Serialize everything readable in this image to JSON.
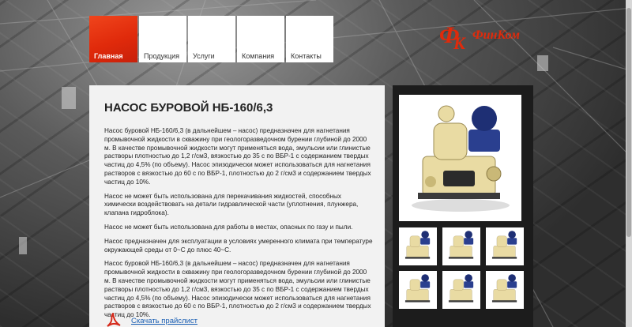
{
  "nav": {
    "items": [
      {
        "label": "Главная",
        "active": true
      },
      {
        "label": "Продукция",
        "active": false
      },
      {
        "label": "Услуги",
        "active": false
      },
      {
        "label": "Компания",
        "active": false
      },
      {
        "label": "Контакты",
        "active": false
      }
    ]
  },
  "logo": {
    "text": "ФинКом"
  },
  "page": {
    "title": "НАСОС БУРОВОЙ НБ-160/6,3",
    "paragraphs": [
      "Насос буровой НБ-160/6,3 (в дальнейшем – насос) предназначен для нагнетания промывочной жидкости в скважину при геологоразведочном бурении глубиной до 2000 м. В качестве промывочной жидкости могут применяться вода, эмульсии или глинистые растворы плотностью до 1,2 г/см3, вязкостью до 35 с по ВБР-1 с содержанием твердых частиц до 4,5% (по объему). Насос эпизодически может использоваться для нагнетания растворов с вязкостью до 60 с по ВБР-1, плотностью до 2 г/см3 и содержанием твердых частиц до 10%.",
      "Насос не может быть использована для перекачивания жидкостей, способных химически воздействовать на детали гидравлической части (уплотнения, плунжера, клапана гидроблока).",
      "Насос не может быть использована для работы в местах, опасных по газу и пыли.",
      "Насос предназначен для эксплуатации в условиях умеренного климата при температуре окружающей среды от 0~C до плюс 40~C.",
      "Насос буровой НБ-160/6,3 (в дальнейшем – насос) предназначен для нагнетания промывочной жидкости в скважину при геологоразведочном бурении глубиной до 2000 м. В качестве промывочной жидкости могут применяться вода, эмульсии или глинистые растворы плотностью до 1,2 г/см3, вязкостью до 35 с по ВБР-1 с содержанием твердых частиц до 4,5% (по объему). Насос эпизодически может использоваться для нагнетания растворов с вязкостью до 60 с по ВБР-1, плотностью до 2 г/см3 и содержанием твердых частиц до 10%."
    ],
    "pricelist_link": "Скачать прайслист"
  },
  "colors": {
    "accent": "#e02a0b",
    "link": "#1a5fb4",
    "panel": "#f2f2f2",
    "gallery": "#1c1c1c"
  },
  "icons": {
    "pdf": "pdf-icon",
    "photo": "pump-photo"
  }
}
